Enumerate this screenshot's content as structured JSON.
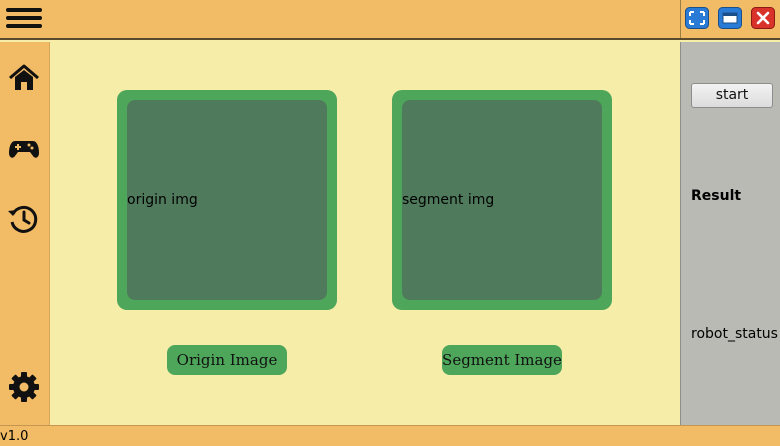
{
  "header": {
    "menu_icon": "hamburger-menu-icon",
    "window_controls": [
      "fullscreen-icon",
      "minimize-icon",
      "close-icon"
    ]
  },
  "sidebar": {
    "items": [
      {
        "icon": "home-icon"
      },
      {
        "icon": "gamepad-icon"
      },
      {
        "icon": "history-icon"
      },
      {
        "icon": "gear-icon"
      }
    ]
  },
  "main": {
    "origin_placeholder": "origin img",
    "segment_placeholder": "segment img",
    "origin_button": "Origin Image",
    "segment_button": "Segment Image"
  },
  "right_panel": {
    "start_label": "start",
    "result_label": "Result",
    "status_label": "robot_status"
  },
  "statusbar": {
    "version": "v1.0"
  },
  "colors": {
    "header_bg": "#f2bb66",
    "main_bg": "#f6eda8",
    "frame_green": "#4ea65a",
    "frame_inner": "#4f7a5c",
    "panel_gray": "#b9bab4"
  }
}
